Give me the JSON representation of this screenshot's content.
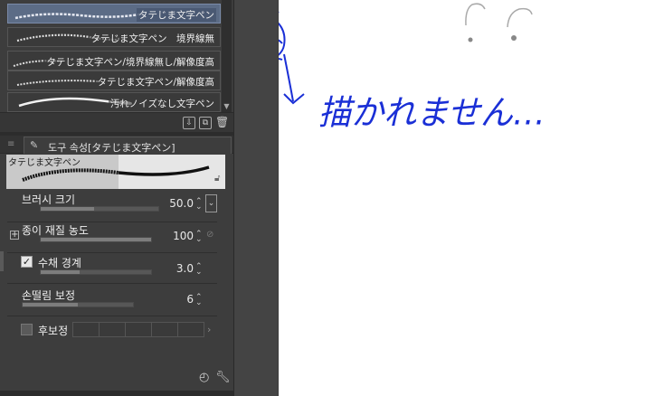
{
  "brush_list": {
    "items": [
      {
        "label": "タテじま文字ペン",
        "selected": true
      },
      {
        "label": "タテじま文字ペン　境界線無",
        "selected": false
      },
      {
        "label": "タテじま文字ペン/境界線無し/解像度高",
        "selected": false
      },
      {
        "label": "タテじま文字ペン/解像度高",
        "selected": false
      },
      {
        "label": "汚れノイズなし文字ペン",
        "selected": false
      }
    ]
  },
  "tool_property": {
    "title": "도구 속성[タテじま文字ペン]",
    "preview_label": "タテじま文字ペン",
    "rows": {
      "brush_size": {
        "label": "브러시 크기",
        "value": "50.0",
        "fill": 0.45
      },
      "paper_texture": {
        "label": "종이 재질 농도",
        "value": "100",
        "fill": 1.0
      },
      "watercolor_edge": {
        "label": "수채 경계",
        "value": "3.0",
        "fill": 0.35,
        "checked": true
      },
      "stabilization": {
        "label": "손떨림 보정",
        "value": "6",
        "fill": 0.5
      },
      "post_correction": {
        "label": "후보정",
        "checked": false
      }
    }
  },
  "canvas": {
    "handwritten_text": "描かれません…"
  },
  "colors": {
    "panel_bg": "#3d3d3d",
    "selected_item": "#5c6c86",
    "ink_blue": "#1a2fd6"
  }
}
